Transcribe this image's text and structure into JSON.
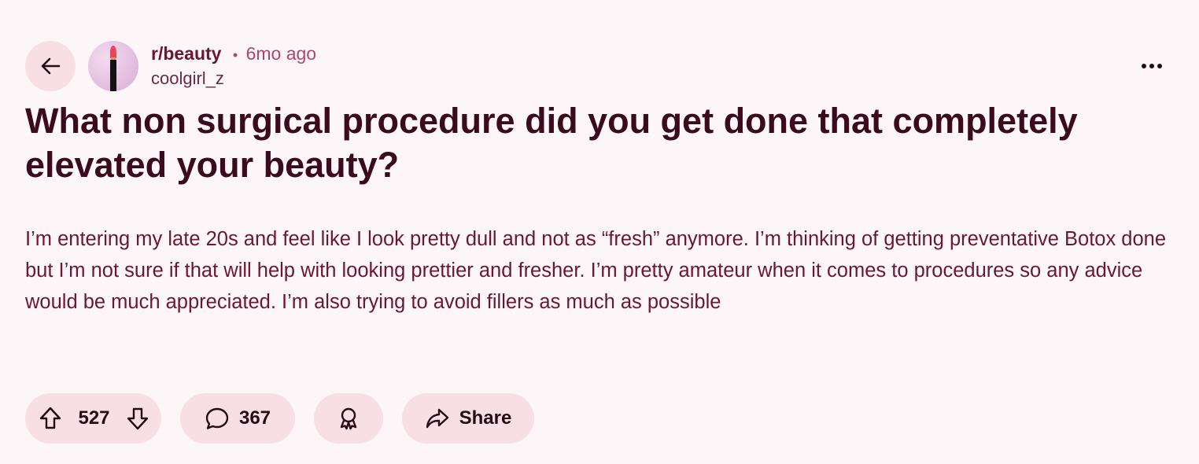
{
  "post": {
    "subreddit": "r/beauty",
    "separator": "•",
    "time_ago": "6mo ago",
    "author": "coolgirl_z",
    "title": "What non surgical procedure did you get done that completely elevated your beauty?",
    "body": "I’m entering my late 20s and feel like I look pretty dull and not as “fresh” anymore. I’m thinking of getting preventative Botox done but I’m not sure if that will help with looking prettier and fresher. I’m pretty amateur when it comes to procedures so any advice would be much appreciated. I’m also trying to avoid fillers as much as possible"
  },
  "actions": {
    "vote_count": "527",
    "comment_count": "367",
    "share_label": "Share"
  },
  "icons": {
    "back": "back-arrow-icon",
    "more": "more-options-icon",
    "upvote": "upvote-arrow-icon",
    "downvote": "downvote-arrow-icon",
    "comment": "comment-bubble-icon",
    "award": "award-icon",
    "share": "share-arrow-icon"
  },
  "colors": {
    "background": "#fdf6f8",
    "pill": "#f7dfe5",
    "title": "#3b0a1c",
    "body": "#6b1633",
    "accent": "#b0476b"
  }
}
